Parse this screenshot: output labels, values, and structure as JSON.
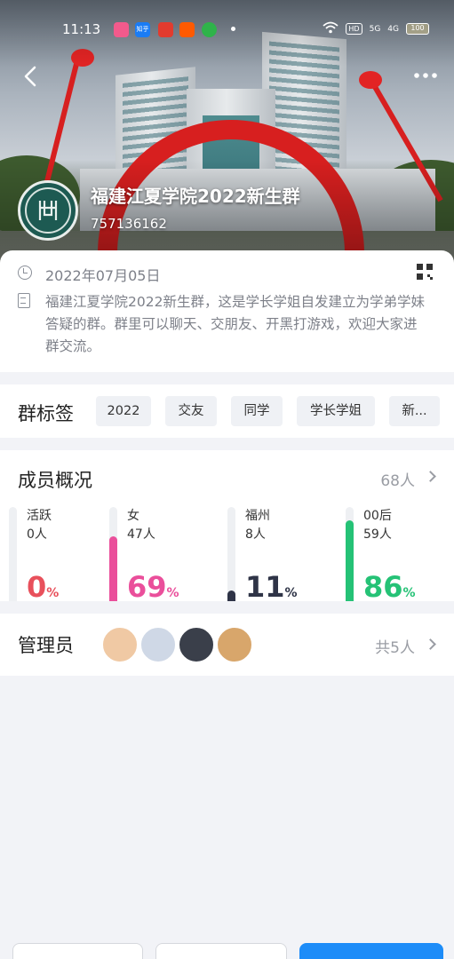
{
  "status_bar": {
    "time": "11:13",
    "app_icons": [
      {
        "name": "vivo-app-icon",
        "color": "#f25a8c"
      },
      {
        "name": "zhihu-icon",
        "color": "#1a7cf5",
        "text": "知乎"
      },
      {
        "name": "toutiao-icon",
        "color": "#e23b2e"
      },
      {
        "name": "taobao-icon",
        "color": "#ff5a00"
      },
      {
        "name": "iqiyi-icon",
        "color": "#2fb34a"
      }
    ],
    "hd_label": "HD",
    "net_5g": "5G",
    "net_4g": "4G",
    "battery": "100"
  },
  "header": {
    "group_name": "福建江夏学院2022新生群",
    "group_id": "757136162",
    "avatar_text": "⿳"
  },
  "info": {
    "date": "2022年07月05日",
    "description": "福建江夏学院2022新生群，这是学长学姐自发建立为学弟学妹答疑的群。群里可以聊天、交朋友、开黑打游戏，欢迎大家进群交流。"
  },
  "tags": {
    "title": "群标签",
    "items": [
      "2022",
      "交友",
      "同学",
      "学长学姐",
      "新..."
    ]
  },
  "members": {
    "title": "成员概况",
    "total": "68人",
    "stats": [
      {
        "label": "活跃",
        "count": "0人",
        "percent": "0",
        "fraction": 0.0,
        "color": "#e8505b"
      },
      {
        "label": "女",
        "count": "47人",
        "percent": "69",
        "fraction": 0.69,
        "color": "#ea4f9b"
      },
      {
        "label": "福州",
        "count": "8人",
        "percent": "11",
        "fraction": 0.11,
        "color": "#2f3447"
      },
      {
        "label": "00后",
        "count": "59人",
        "percent": "86",
        "fraction": 0.86,
        "color": "#25c276"
      }
    ],
    "percent_sign": "%"
  },
  "admins": {
    "title": "管理员",
    "count": "共5人",
    "avatars": [
      {
        "name": "admin-avatar-1",
        "color": "#f0c9a4"
      },
      {
        "name": "admin-avatar-2",
        "color": "#cfd8e6"
      },
      {
        "name": "admin-avatar-3",
        "color": "#3a3f4a"
      },
      {
        "name": "admin-avatar-4",
        "color": "#d8a66b"
      }
    ]
  },
  "colors": {
    "accent_blue": "#1d8cf8",
    "banner_red": "#d71f1f"
  }
}
